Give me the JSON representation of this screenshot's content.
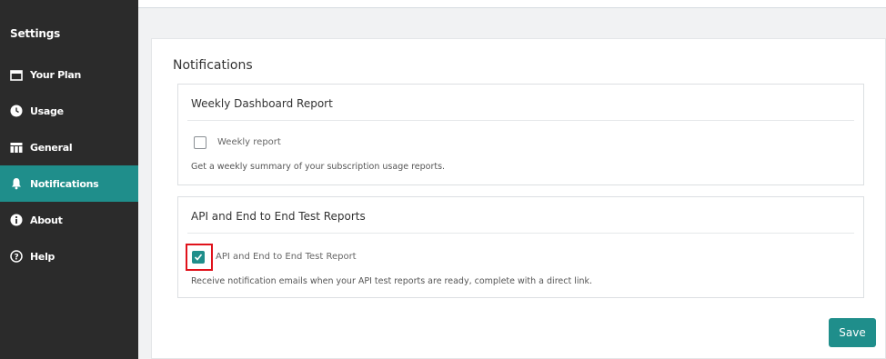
{
  "sidebar": {
    "title": "Settings",
    "items": [
      {
        "label": "Your Plan",
        "icon": "calendar-icon"
      },
      {
        "label": "Usage",
        "icon": "clock-icon"
      },
      {
        "label": "General",
        "icon": "table-icon"
      },
      {
        "label": "Notifications",
        "icon": "bell-icon",
        "active": true
      },
      {
        "label": "About",
        "icon": "info-icon"
      },
      {
        "label": "Help",
        "icon": "help-icon"
      }
    ]
  },
  "main": {
    "title": "Notifications",
    "sections": [
      {
        "heading": "Weekly Dashboard Report",
        "checkbox_label": "Weekly report",
        "checked": false,
        "description": "Get a weekly summary of your subscription usage reports."
      },
      {
        "heading": "API and End to End Test Reports",
        "checkbox_label": "API and End to End Test Report",
        "checked": true,
        "description": "Receive notification emails when your API test reports are ready, complete with a direct link."
      }
    ],
    "save_label": "Save"
  },
  "colors": {
    "sidebar_bg": "#2b2b2b",
    "accent": "#1f8e8b",
    "highlight": "#e0121b"
  }
}
